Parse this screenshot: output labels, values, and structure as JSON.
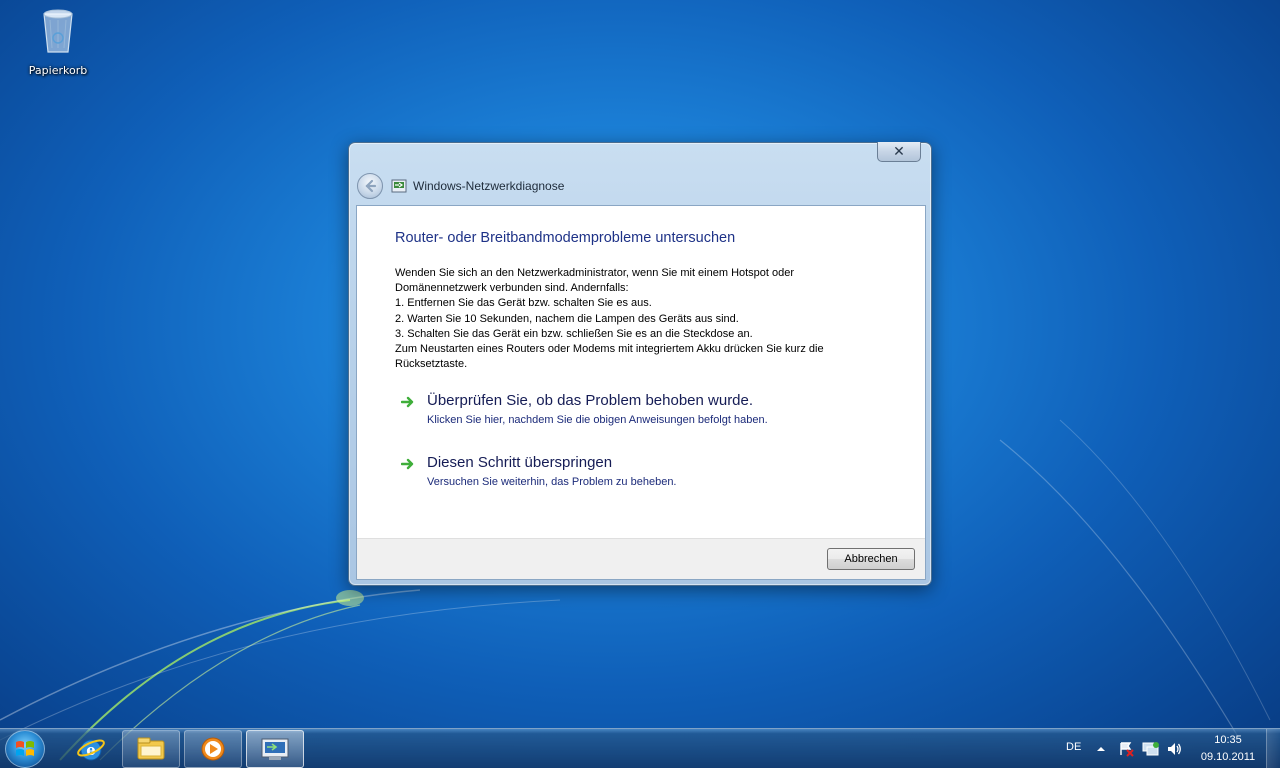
{
  "desktop": {
    "icons": [
      {
        "label": "Papierkorb",
        "icon": "recycle-bin-icon"
      }
    ]
  },
  "dialog": {
    "title": "Windows-Netzwerkdiagnose",
    "close_label": "✕",
    "heading": "Router- oder Breitbandmodemprobleme untersuchen",
    "description_lines": [
      "Wenden Sie sich an den Netzwerkadministrator, wenn Sie mit einem Hotspot oder",
      "Domänennetzwerk verbunden sind. Andernfalls:",
      " 1. Entfernen Sie das Gerät bzw. schalten Sie es aus.",
      " 2. Warten Sie 10 Sekunden, nachem die Lampen des Geräts aus sind.",
      " 3. Schalten Sie das Gerät ein bzw. schließen Sie es an die Steckdose an.",
      "Zum Neustarten eines Routers oder Modems mit integriertem Akku drücken Sie kurz die",
      "Rücksetztaste."
    ],
    "options": [
      {
        "title": "Überprüfen Sie, ob das Problem behoben wurde.",
        "subtitle": "Klicken Sie hier, nachdem Sie die obigen Anweisungen befolgt haben."
      },
      {
        "title": "Diesen Schritt überspringen",
        "subtitle": "Versuchen Sie weiterhin, das Problem zu beheben."
      }
    ],
    "cancel_label": "Abbrechen"
  },
  "taskbar": {
    "pinned": [
      {
        "name": "internet-explorer-icon"
      },
      {
        "name": "windows-explorer-icon"
      },
      {
        "name": "media-player-icon"
      },
      {
        "name": "network-diagnostics-icon"
      }
    ],
    "tray": {
      "language": "DE",
      "time": "10:35",
      "date": "09.10.2011"
    }
  },
  "colors": {
    "heading": "#1e3287",
    "link": "#151c55",
    "arrow": "#3fae3a",
    "desktop": "#1b7fd6"
  }
}
